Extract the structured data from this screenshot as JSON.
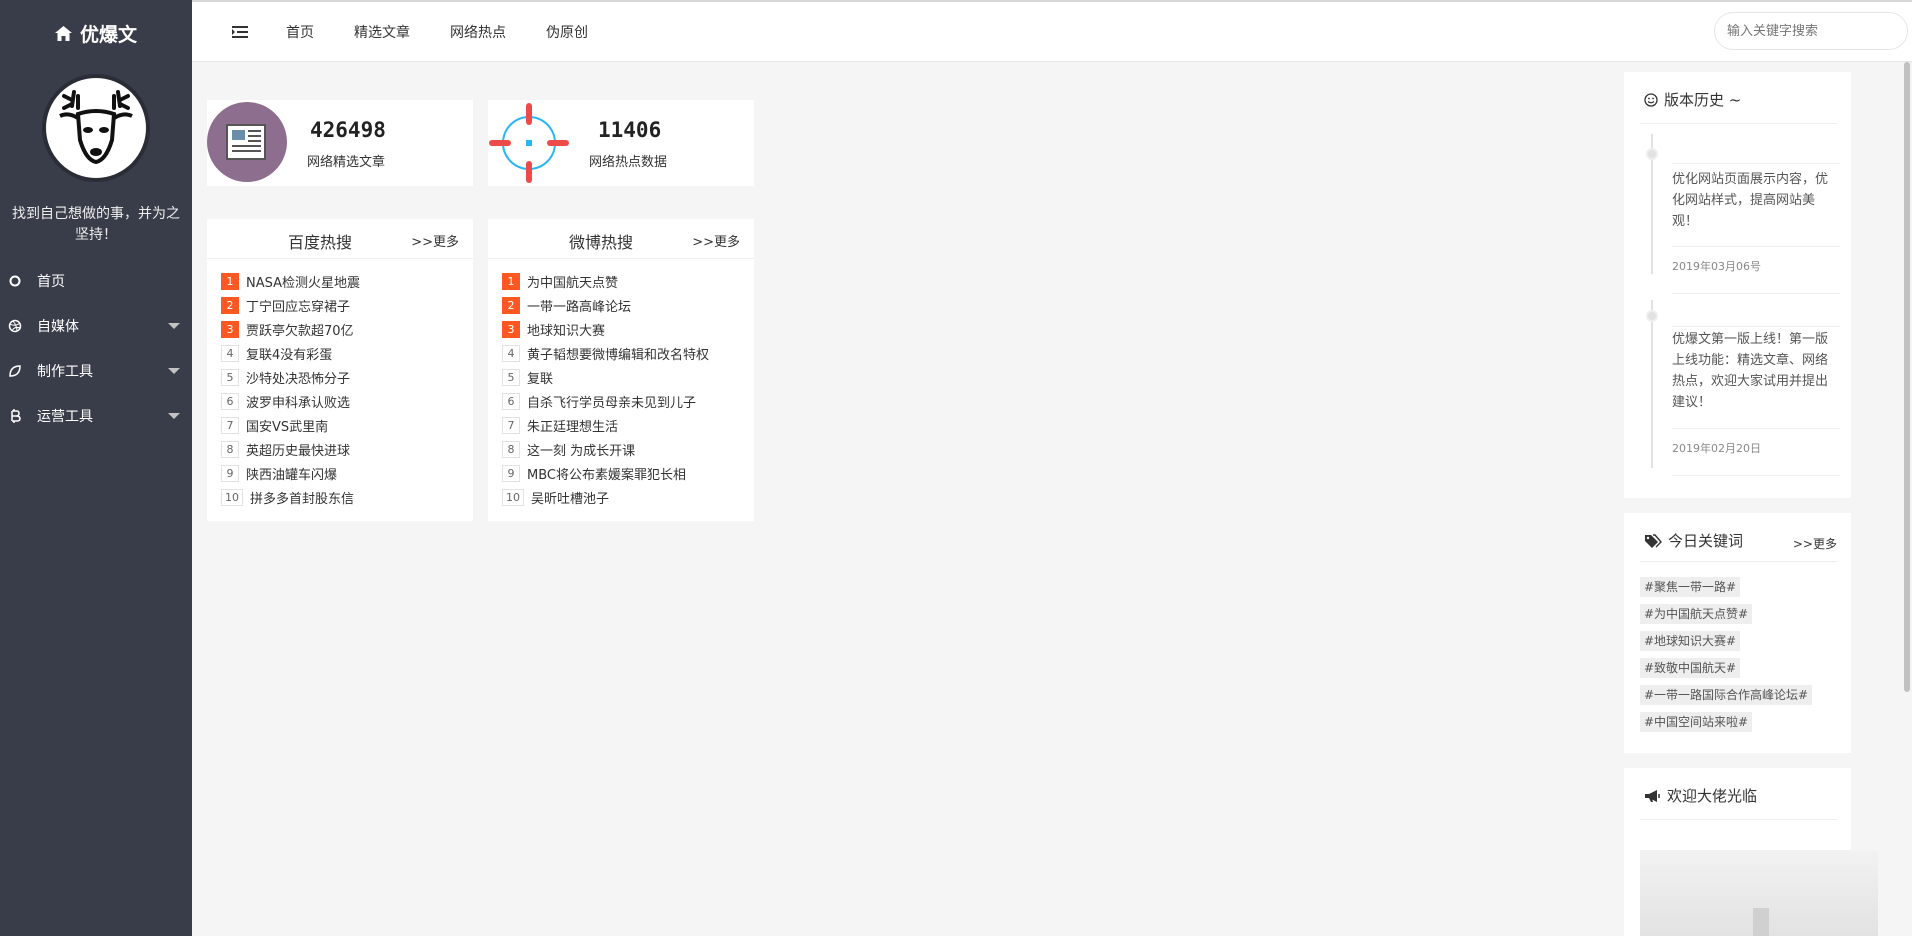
{
  "brand": {
    "title": "优爆文",
    "icon": "home-icon"
  },
  "sidebar": {
    "tagline": "找到自己想做的事，并为之坚持！",
    "items": [
      {
        "label": "首页",
        "icon": "circle-icon",
        "has_submenu": false
      },
      {
        "label": "自媒体",
        "icon": "dribbble-icon",
        "has_submenu": true
      },
      {
        "label": "制作工具",
        "icon": "leaf-icon",
        "has_submenu": true
      },
      {
        "label": "运营工具",
        "icon": "bitcoin-icon",
        "has_submenu": true
      }
    ]
  },
  "topnav": {
    "items": [
      "首页",
      "精选文章",
      "网络热点",
      "伪原创"
    ],
    "search_placeholder": "输入关键字搜索"
  },
  "stats": [
    {
      "value": "426498",
      "label": "网络精选文章",
      "icon": "newspaper-icon",
      "color": "#8e6e8e"
    },
    {
      "value": "11406",
      "label": "网络热点数据",
      "icon": "crosshair-icon",
      "color": "#f44336"
    }
  ],
  "baidu": {
    "title": "百度热搜",
    "more": ">>更多",
    "items": [
      {
        "rank": "1",
        "text": "NASA检测火星地震"
      },
      {
        "rank": "2",
        "text": "丁宁回应忘穿裙子"
      },
      {
        "rank": "3",
        "text": "贾跃亭欠款超70亿"
      },
      {
        "rank": "4",
        "text": "复联4没有彩蛋"
      },
      {
        "rank": "5",
        "text": "沙特处决恐怖分子"
      },
      {
        "rank": "6",
        "text": "波罗申科承认败选"
      },
      {
        "rank": "7",
        "text": "国安VS武里南"
      },
      {
        "rank": "8",
        "text": "英超历史最快进球"
      },
      {
        "rank": "9",
        "text": "陕西油罐车闪爆"
      },
      {
        "rank": "10",
        "text": "拼多多首封股东信"
      }
    ]
  },
  "weibo": {
    "title": "微博热搜",
    "more": ">>更多",
    "items": [
      {
        "rank": "1",
        "text": "为中国航天点赞"
      },
      {
        "rank": "2",
        "text": "一带一路高峰论坛"
      },
      {
        "rank": "3",
        "text": "地球知识大赛"
      },
      {
        "rank": "4",
        "text": "黄子韬想要微博编辑和改名特权"
      },
      {
        "rank": "5",
        "text": "复联"
      },
      {
        "rank": "6",
        "text": "自杀飞行学员母亲未见到儿子"
      },
      {
        "rank": "7",
        "text": "朱正廷理想生活"
      },
      {
        "rank": "8",
        "text": "这一刻 为成长开课"
      },
      {
        "rank": "9",
        "text": "MBC将公布素媛案罪犯长相"
      },
      {
        "rank": "10",
        "text": "吴昕吐槽池子"
      }
    ]
  },
  "history": {
    "title": "版本历史 ~",
    "icon": "smile-icon",
    "entries": [
      {
        "text": "优化网站页面展示内容，优化网站样式，提高网站美观！",
        "date": "2019年03月06号"
      },
      {
        "text": "优爆文第一版上线！第一版上线功能：精选文章、网络热点，欢迎大家试用并提出建议！",
        "date": "2019年02月20日"
      }
    ]
  },
  "keywords": {
    "title": "今日关键词",
    "icon": "tags-icon",
    "more": ">>更多",
    "tags": [
      "#聚焦一带一路#",
      "#为中国航天点赞#",
      "#地球知识大赛#",
      "#致敬中国航天#",
      "#一带一路国际合作高峰论坛#",
      "#中国空间站来啦#"
    ]
  },
  "welcome": {
    "title": "欢迎大佬光临",
    "icon": "bullhorn-icon"
  },
  "colors": {
    "sidebar": "#393d49",
    "accent": "#ff5722",
    "background": "#f5f5f5"
  }
}
